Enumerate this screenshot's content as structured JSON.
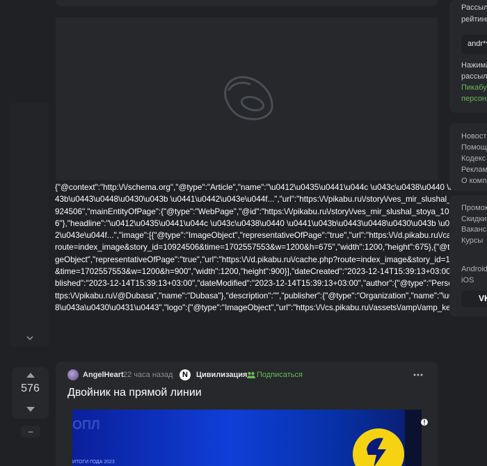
{
  "json_ld_text": "{\"@context\":\"http:\\/\\/schema.org\",\"@type\":\"Article\",\"name\":\"\\u0412\\u0435\\u0441\\u044c \\u043c\\u0438\\u0440 \\u0441\\u043b\\u0443\\u0448\\u0430\\u043b \\u0441\\u0442\\u043e\\u044f...\",\"url\":\"https:\\/\\/pikabu.ru\\/story\\/ves_mir_slushal_stoya_10924506\",\"mainEntityOfPage\":{\"@type\":\"WebPage\",\"@id\":\"https:\\/\\/pikabu.ru\\/story\\/ves_mir_slushal_stoya_10924506\"},\"headline\":\"\\u0412\\u0435\\u0441\\u044c \\u043c\\u0438\\u0440 \\u0441\\u043b\\u0443\\u0448\\u0430\\u043b \\u0441\\u0442\\u043e\\u044f...\",\"image\":[{\"@type\":\"ImageObject\",\"representativeOfPage\":\"true\",\"url\":\"https:\\/\\/d.pikabu.ru\\/cache.php?route=index_image&story_id=10924506&time=1702557553&w=1200&h=675\",\"width\":1200,\"height\":675},{\"@type\":\"ImageObject\",\"representativeOfPage\":\"true\",\"url\":\"https:\\/\\/d.pikabu.ru\\/cache.php?route=index_image&story_id=10924506&time=1702557553&w=1200&h=900\",\"width\":1200,\"height\":900}],\"dateCreated\":\"2023-12-14T15:39:13+03:00\",\"datePublished\":\"2023-12-14T15:39:13+03:00\",\"dateModified\":\"2023-12-14T15:39:13+03:00\",\"author\":{\"@type\":\"Person\",\"url\":\"https:\\/\\/pikabu.ru\\/@Dubasa\",\"name\":\"Dubasa\"},\"description\":\"\",\"publisher\":{\"@type\":\"Organization\",\"name\":\"\\u041f\\u0438\\u043a\\u0430\\u0431\\u0443\",\"logo\":{\"@type\":\"ImageObject\",\"url\":\"https:\\/\\/cs.pikabu.ru\\/assets\\/amp\\/amp_keks.png\"}}}",
  "sidebar": {
    "newsletter_lines": [
      "Рассыл",
      "рейтинг"
    ],
    "email_value": "andr**",
    "consent_lines": [
      "Нажима",
      "рассыл"
    ],
    "consent_link_lines": [
      "Пикабу",
      "персона"
    ],
    "footer_links": [
      "Новост",
      "Помощ",
      "Кодекс",
      "Реклам",
      "О компа"
    ],
    "footer_links_2": [
      "Промок",
      "Скидки",
      "Ваканси",
      "Курсы"
    ],
    "app_label": "Android",
    "app_label_2": "iOS",
    "vk_label": "VK"
  },
  "vote": {
    "count": "576",
    "minus": "–"
  },
  "post": {
    "author": "AngelHeart",
    "time": "22 часа назад",
    "community_icon_letter": "N",
    "community": "Цивилизация",
    "subscribe": "Подписаться",
    "title": "Двойник на прямой линии",
    "image_caption": "ИТОГИ ГОДА 2023",
    "image_ghost_text": "ОПЛ"
  }
}
